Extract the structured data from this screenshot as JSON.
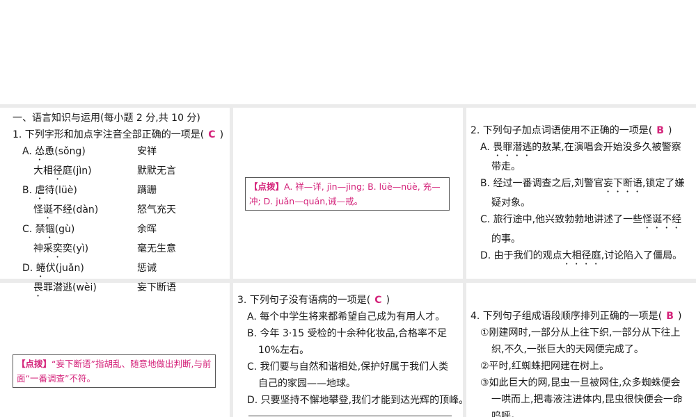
{
  "section_title": "一、语言知识与运用(每小题 2 分,共 10 分)",
  "q1": {
    "stem": "1. 下列字形和加点字注音全部正确的一项是(",
    "answer": "C",
    "close": ")",
    "options": [
      {
        "label": "A. ",
        "a_pre": "",
        "a_dot": "怂",
        "a_post": "恿(sǒng)",
        "b": "安祥"
      },
      {
        "label": "",
        "a_pre": "大相",
        "a_dot": "径",
        "a_post": "庭(jìn)",
        "b": "默默无言"
      },
      {
        "label": "B. ",
        "a_pre": "",
        "a_dot": "虐",
        "a_post": "待(lüè)",
        "b": "蹒跚"
      },
      {
        "label": "",
        "a_pre": "怪",
        "a_dot": "诞",
        "a_post": "不经(dàn)",
        "b": "怒气充天"
      },
      {
        "label": "C. ",
        "a_pre": "禁",
        "a_dot": "锢",
        "a_post": "(gù)",
        "b": "余晖"
      },
      {
        "label": "",
        "a_pre": "神采",
        "a_dot": "奕",
        "a_post": "奕(yì)",
        "b": "毫无生意"
      },
      {
        "label": "D. ",
        "a_pre": "",
        "a_dot": "蜷",
        "a_post": "伏(juǎn)",
        "b": "惩诫"
      },
      {
        "label": "",
        "a_pre": "",
        "a_dot": "畏",
        "a_post": "罪潜逃(wèi)",
        "b": "妄下断语"
      }
    ]
  },
  "note1": {
    "tag": "【点拨】",
    "text": "A. 祥—详, jìn—jìng; B. lüè—nüè, 充—冲; D. juǎn—quán,诫—戒。"
  },
  "q2": {
    "stem": "2. 下列句子加点词语使用不正确的一项是(",
    "answer": "B",
    "close": ")",
    "a1_label": "A. ",
    "a1_dot": "畏罪潜逃",
    "a1_post": "的敖某,在演唱会开始没多久被警察",
    "a2": "带走。",
    "b1_pre": "B. 经过一番调查之后,刘警官",
    "b1_dot": "妄下断语",
    "b1_post": ",锁定了嫌",
    "b2": "疑对象。",
    "c1_pre": "C. 旅行途中,他兴致勃勃地讲述了一些",
    "c1_dot": "怪诞不经",
    "c2": "的事。",
    "d_pre": "D. 由于我们的观点",
    "d_dot": "大相径庭",
    "d_post": ",讨论陷入了僵局。"
  },
  "note2": {
    "tag": "【点拨】",
    "text": "“妄下断语”指胡乱、随意地做出判断,与前面“一番调查”不符。"
  },
  "q3": {
    "stem": "3. 下列句子没有语病的一项是(",
    "answer": "C",
    "close": ")",
    "lines": [
      "A. 每个中学生将来都希望自己成为有用人才。",
      "B. 今年 3·15 受检的十余种化妆品,合格率不足",
      "10%左右。",
      "C. 我们要与自然和谐相处,保护好属于我们人类",
      "自己的家园——地球。",
      "D. 只要坚持不懈地攀登,我们才能到达光辉的顶峰。"
    ]
  },
  "q4": {
    "stem": "4. 下列句子组成语段顺序排列正确的一项是(",
    "answer": "B",
    "close": ")",
    "lines": [
      "①刚建网时,一部分从上往下织,一部分从下往上",
      "织,不久,一张巨大的天网便完成了。",
      "②平时,红蜘蛛把网建在树上。",
      "③如此巨大的网,昆虫一旦被网住,众多蜘蛛便会",
      "一哄而上,把毒液注进体内,昆虫很快便会一命",
      "呜呼。"
    ]
  },
  "colors": {
    "answer": "#d4237a",
    "divider": "#ebebeb"
  }
}
